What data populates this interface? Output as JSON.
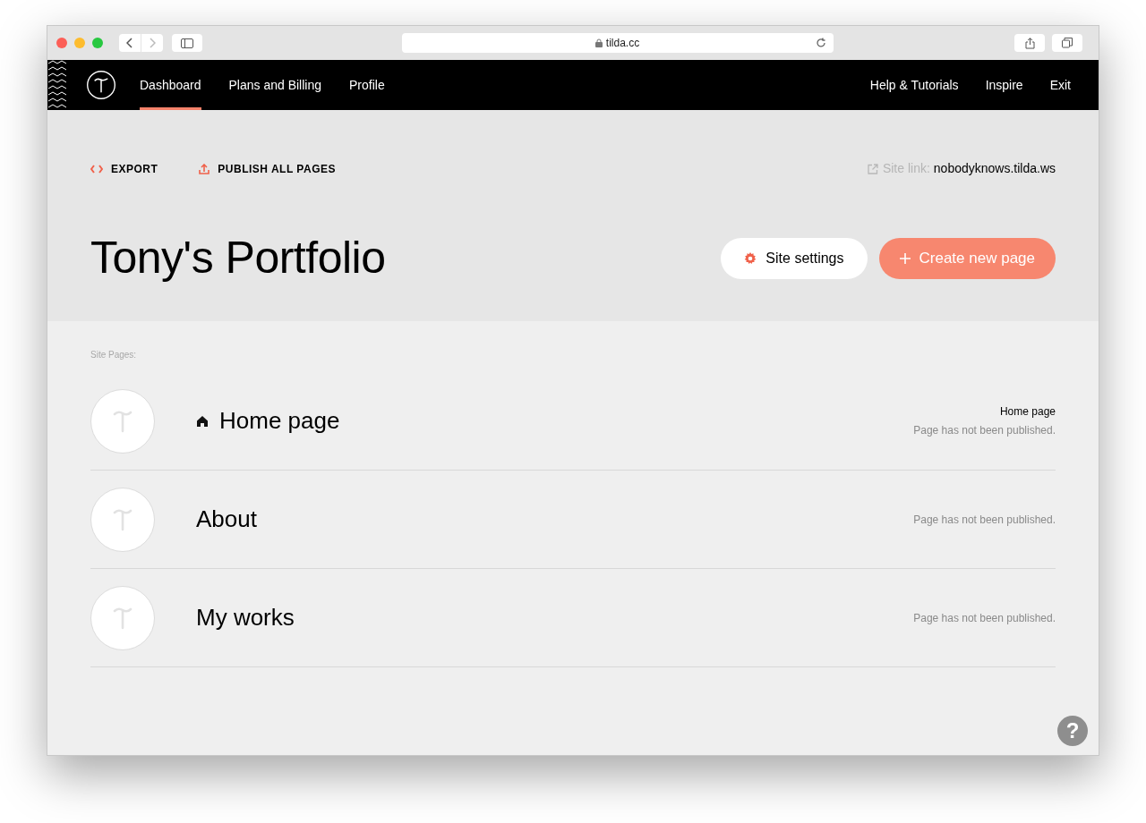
{
  "browser": {
    "address": "tilda.cc"
  },
  "nav": {
    "left": [
      {
        "label": "Dashboard",
        "selected": true
      },
      {
        "label": "Plans and Billing",
        "selected": false
      },
      {
        "label": "Profile",
        "selected": false
      }
    ],
    "right": [
      "Help & Tutorials",
      "Inspire",
      "Exit"
    ]
  },
  "actions": [
    {
      "kind": "export",
      "label": "EXPORT"
    },
    {
      "kind": "publish",
      "label": "PUBLISH ALL PAGES"
    }
  ],
  "site_link": {
    "label": "Site link:",
    "url": "nobodyknows.tilda.ws"
  },
  "project_title": "Tony's Portfolio",
  "buttons": {
    "settings": "Site settings",
    "create": "Create new page"
  },
  "pages_heading": "Site Pages:",
  "pages": [
    {
      "title": "Home page",
      "home": true,
      "tag": "Home page",
      "status": "Page has not been published."
    },
    {
      "title": "About",
      "home": false,
      "status": "Page has not been published."
    },
    {
      "title": "My works",
      "home": false,
      "status": "Page has not been published."
    }
  ],
  "help": "?"
}
